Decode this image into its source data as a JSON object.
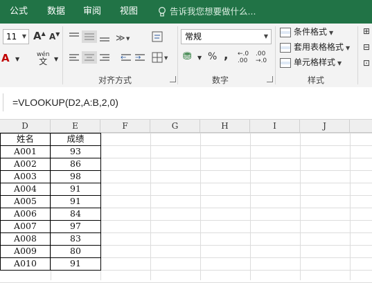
{
  "ribbon_tabs": [
    "公式",
    "数据",
    "审阅",
    "视图"
  ],
  "tell_me": "告诉我您想要做什么...",
  "font": {
    "size": "11",
    "grow": "A",
    "shrink": "A",
    "wen": "wén",
    "wen_char": "文"
  },
  "align_group_label": "对齐方式",
  "number": {
    "format": "常规",
    "percent": "%",
    "comma": ",",
    "inc_decimal": "←.0 .00",
    "dec_decimal": ".00 →.0",
    "group_label": "数字"
  },
  "styles": {
    "conditional": "条件格式",
    "table": "套用表格格式",
    "cell": "单元格样式",
    "group_label": "样式"
  },
  "formula": "=VLOOKUP(D2,A:B,2,0)",
  "columns": [
    "D",
    "E",
    "F",
    "G",
    "H",
    "I",
    "J"
  ],
  "table": {
    "headers": [
      "姓名",
      "成绩"
    ],
    "rows": [
      [
        "A001",
        "93"
      ],
      [
        "A002",
        "86"
      ],
      [
        "A003",
        "98"
      ],
      [
        "A004",
        "91"
      ],
      [
        "A005",
        "91"
      ],
      [
        "A006",
        "84"
      ],
      [
        "A007",
        "97"
      ],
      [
        "A008",
        "83"
      ],
      [
        "A009",
        "80"
      ],
      [
        "A010",
        "91"
      ]
    ]
  },
  "colors": {
    "ribbon_green": "#217346",
    "ribbon_bg": "#f3f3f3",
    "font_color_red": "#c00000"
  }
}
